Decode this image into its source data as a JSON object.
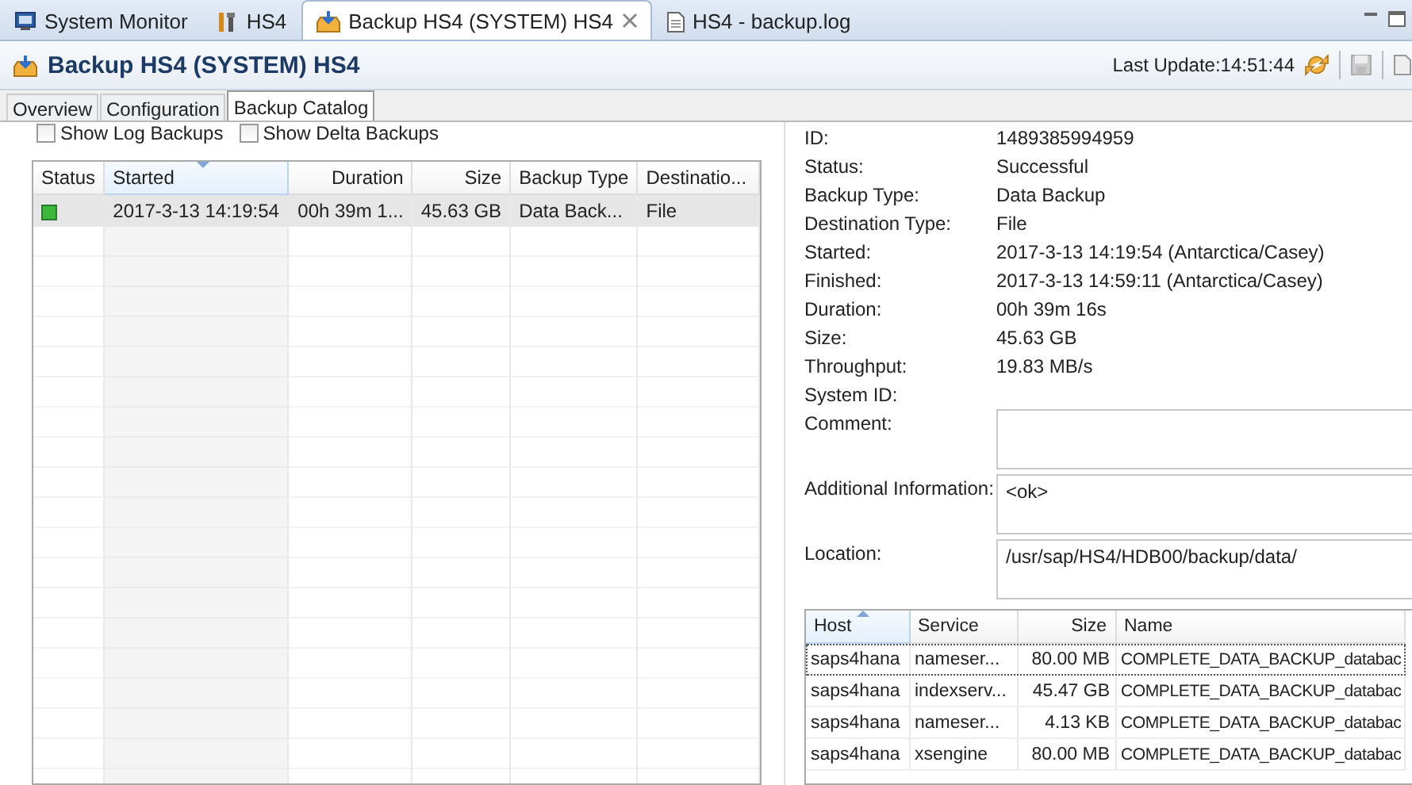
{
  "editor_tabs": [
    {
      "label": "System Monitor",
      "kind": "monitor",
      "selected": false
    },
    {
      "label": "HS4",
      "kind": "tools",
      "selected": false
    },
    {
      "label": "Backup HS4 (SYSTEM) HS4",
      "kind": "backup",
      "selected": true
    },
    {
      "label": "HS4 - backup.log",
      "kind": "file",
      "selected": false
    }
  ],
  "header": {
    "title": "Backup HS4 (SYSTEM) HS4",
    "last_update": "Last Update:14:51:44"
  },
  "sub_tabs": [
    {
      "label": "Overview",
      "selected": false
    },
    {
      "label": "Configuration",
      "selected": false
    },
    {
      "label": "Backup Catalog",
      "selected": true
    }
  ],
  "options": [
    {
      "label": "Show Log Backups",
      "checked": false
    },
    {
      "label": "Show Delta Backups",
      "checked": false
    }
  ],
  "catalog": {
    "columns": [
      {
        "label": "Status",
        "sorted": false
      },
      {
        "label": "Started",
        "sorted": true
      },
      {
        "label": "Duration",
        "sorted": false
      },
      {
        "label": "Size",
        "sorted": false
      },
      {
        "label": "Backup Type",
        "sorted": false
      },
      {
        "label": "Destinatio...",
        "sorted": false
      }
    ],
    "rows": [
      {
        "color": "#3cb83c",
        "selected": true,
        "cells": [
          "",
          "2017-3-13 14:19:54",
          "00h 39m 1...",
          "45.63 GB",
          "Data Back...",
          "File"
        ]
      }
    ]
  },
  "details": {
    "fields": [
      {
        "kind": "text",
        "label": "ID:",
        "value": "1489385994959"
      },
      {
        "kind": "text",
        "label": "Status:",
        "value": "Successful"
      },
      {
        "kind": "text",
        "label": "Backup Type:",
        "value": "Data Backup"
      },
      {
        "kind": "text",
        "label": "Destination Type:",
        "value": "File"
      },
      {
        "kind": "text",
        "label": "Started:",
        "value": "2017-3-13 14:19:54 (Antarctica/Casey)"
      },
      {
        "kind": "text",
        "label": "Finished:",
        "value": "2017-3-13 14:59:11 (Antarctica/Casey)"
      },
      {
        "kind": "text",
        "label": "Duration:",
        "value": "00h 39m 16s"
      },
      {
        "kind": "text",
        "label": "Size:",
        "value": "45.63 GB"
      },
      {
        "kind": "text",
        "label": "Throughput:",
        "value": "19.83 MB/s"
      },
      {
        "kind": "text",
        "label": "System ID:"
      },
      {
        "kind": "box",
        "label": "Comment:"
      },
      {
        "kind": "box",
        "label": "Additional Information:",
        "value": "<ok>"
      },
      {
        "kind": "box",
        "label": "Location:",
        "value": "/usr/sap/HS4/HDB00/backup/data/"
      }
    ]
  },
  "files": {
    "columns": [
      {
        "label": "Host",
        "sorted": true
      },
      {
        "label": "Service",
        "sorted": false
      },
      {
        "label": "Size",
        "sorted": false
      },
      {
        "label": "Name",
        "sorted": false
      }
    ],
    "rows": [
      {
        "focused": true,
        "cells": [
          "saps4hana",
          "nameser...",
          "80.00 MB",
          "COMPLETE_DATA_BACKUP_databac"
        ]
      },
      {
        "focused": false,
        "cells": [
          "saps4hana",
          "indexserv...",
          "45.47 GB",
          "COMPLETE_DATA_BACKUP_databac"
        ]
      },
      {
        "focused": false,
        "cells": [
          "saps4hana",
          "nameser...",
          "4.13 KB",
          "COMPLETE_DATA_BACKUP_databac"
        ]
      },
      {
        "focused": false,
        "cells": [
          "saps4hana",
          "xsengine",
          "80.00 MB",
          "COMPLETE_DATA_BACKUP_databac"
        ]
      }
    ]
  }
}
